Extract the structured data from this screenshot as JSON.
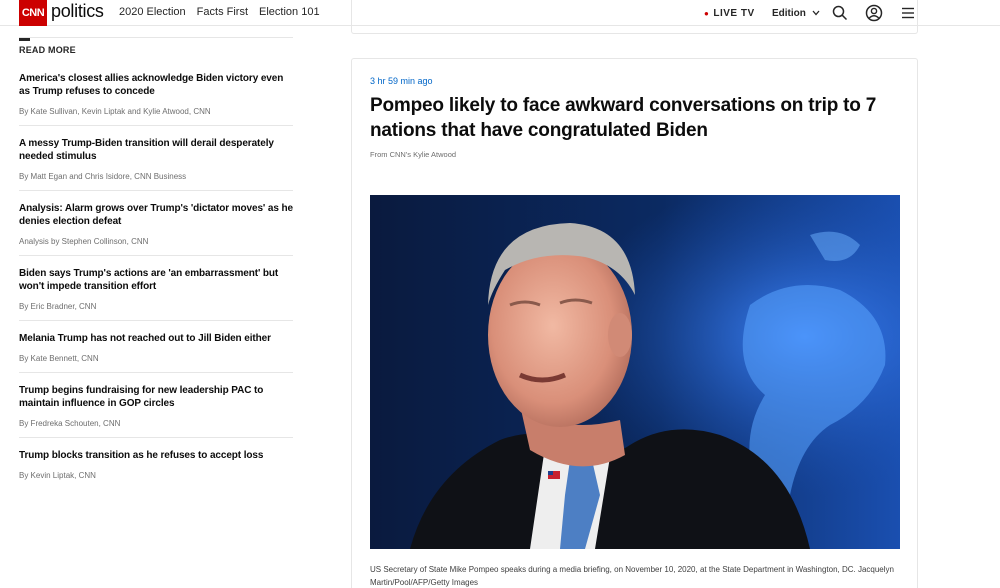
{
  "header": {
    "logo_text": "CNN",
    "section_name": "politics",
    "nav": [
      "2020 Election",
      "Facts First",
      "Election 101"
    ],
    "live_label": "LIVE TV",
    "edition_label": "Edition",
    "brand_color": "#cc0000"
  },
  "sidebar": {
    "heading": "READ MORE",
    "items": [
      {
        "title": "America's closest allies acknowledge Biden victory even as Trump refuses to concede",
        "byline": "By Kate Sullivan, Kevin Liptak and Kylie Atwood, CNN"
      },
      {
        "title": "A messy Trump-Biden transition will derail desperately needed stimulus",
        "byline": "By Matt Egan and Chris Isidore, CNN Business"
      },
      {
        "title": "Analysis: Alarm grows over Trump's 'dictator moves' as he denies election defeat",
        "byline": "Analysis by Stephen Collinson, CNN"
      },
      {
        "title": "Biden says Trump's actions are 'an embarrassment' but won't impede transition effort",
        "byline": "By Eric Bradner, CNN"
      },
      {
        "title": "Melania Trump has not reached out to Jill Biden either",
        "byline": "By Kate Bennett, CNN"
      },
      {
        "title": "Trump begins fundraising for new leadership PAC to maintain influence in GOP circles",
        "byline": "By Fredreka Schouten, CNN"
      },
      {
        "title": "Trump blocks transition as he refuses to accept loss",
        "byline": "By Kevin Liptak, CNN"
      }
    ]
  },
  "post": {
    "timestamp": "3 hr 59 min ago",
    "headline": "Pompeo likely to face awkward conversations on trip to 7 nations that have congratulated Biden",
    "source": "From CNN's Kylie Atwood",
    "caption": "US Secretary of State Mike Pompeo speaks during a media briefing, on November 10, 2020, at the State Department in Washington, DC. Jacquelyn Martin/Pool/AFP/Getty Images",
    "timestamp_color": "#0066c8"
  },
  "icons": [
    "search-icon",
    "account-icon",
    "menu-icon",
    "chevron-down-icon"
  ]
}
